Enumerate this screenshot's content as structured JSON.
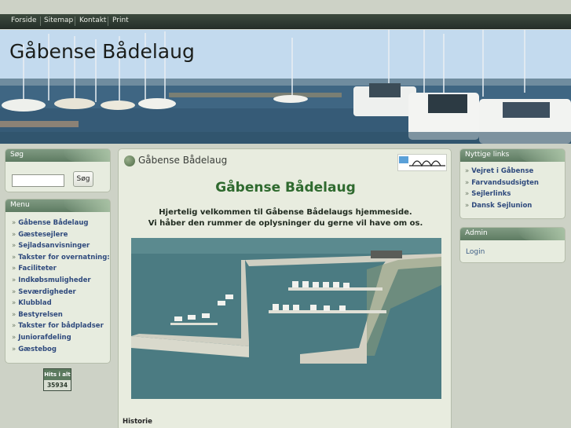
{
  "topnav": [
    "Forside",
    "Sitemap",
    "Kontakt",
    "Print"
  ],
  "site_title": "Gåbense Bådelaug",
  "search": {
    "title": "Søg",
    "button_label": "Søg",
    "value": ""
  },
  "menu": {
    "title": "Menu",
    "items": [
      "Gåbense Bådelaug",
      "Gæstesejlere",
      "Sejladsanvisninger",
      "Takster for overnatning:",
      "Faciliteter",
      "Indkøbsmuligheder",
      "Seværdigheder",
      "Klubblad",
      "Bestyrelsen",
      "Takster for bådpladser",
      "Juniorafdeling",
      "Gæstebog"
    ]
  },
  "hits": {
    "label": "Hits i alt",
    "value": "35934"
  },
  "main": {
    "title": "Gåbense Bådelaug",
    "heading": "Gåbense Bådelaug",
    "welcome_line1": "Hjertelig velkommen til Gåbense Bådelaugs hjemmeside.",
    "welcome_line2": "Vi håber den rummer de oplysninger du gerne vil have om os.",
    "section_label": "Historie"
  },
  "useful_links": {
    "title": "Nyttige links",
    "items": [
      "Vejret i Gåbense",
      "Farvandsudsigten",
      "Sejlerlinks",
      "Dansk Sejlunion"
    ]
  },
  "admin": {
    "title": "Admin",
    "login_label": "Login"
  },
  "colors": {
    "nav_bar": "#2f3b33",
    "box_header": "#6e8b71",
    "link": "#2f4a7d",
    "heading": "#2f6a2f",
    "page_bg": "#cdd2c6"
  }
}
